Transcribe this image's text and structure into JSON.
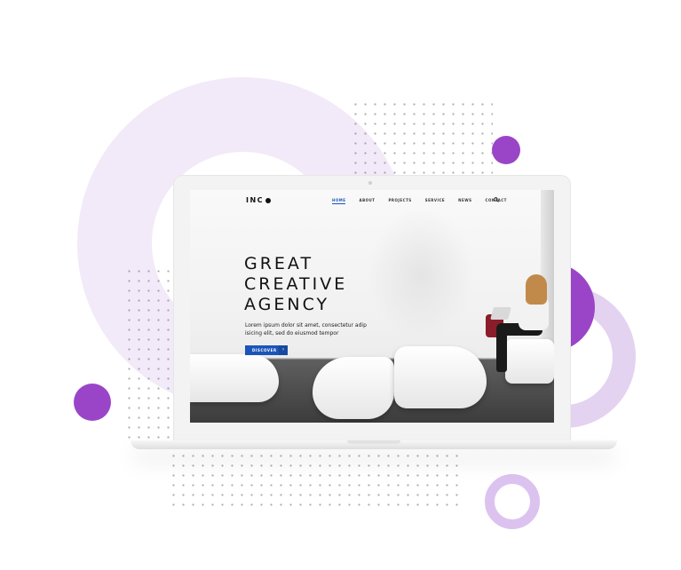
{
  "site": {
    "logo_text": "INC",
    "nav": {
      "items": [
        {
          "label": "HOME",
          "active": true
        },
        {
          "label": "ABOUT",
          "active": false
        },
        {
          "label": "PROJECTS",
          "active": false
        },
        {
          "label": "SERVICE",
          "active": false
        },
        {
          "label": "NEWS",
          "active": false
        },
        {
          "label": "CONTACT",
          "active": false
        }
      ],
      "search_icon": "search-icon"
    },
    "hero": {
      "headline_lines": [
        "GREAT",
        "CREATIVE",
        "AGENCY"
      ],
      "subtext": "Lorem ipsum dolor sit amet, consectetur adip isicing elit, sed do eiusmod tempor",
      "cta_label": "DISCOVER",
      "cta_icon": "chevron-right-icon"
    }
  },
  "colors": {
    "accent_blue": "#1b55b8",
    "decor_purple": "#9a45c8",
    "decor_lavender": "#f2eaf8"
  }
}
